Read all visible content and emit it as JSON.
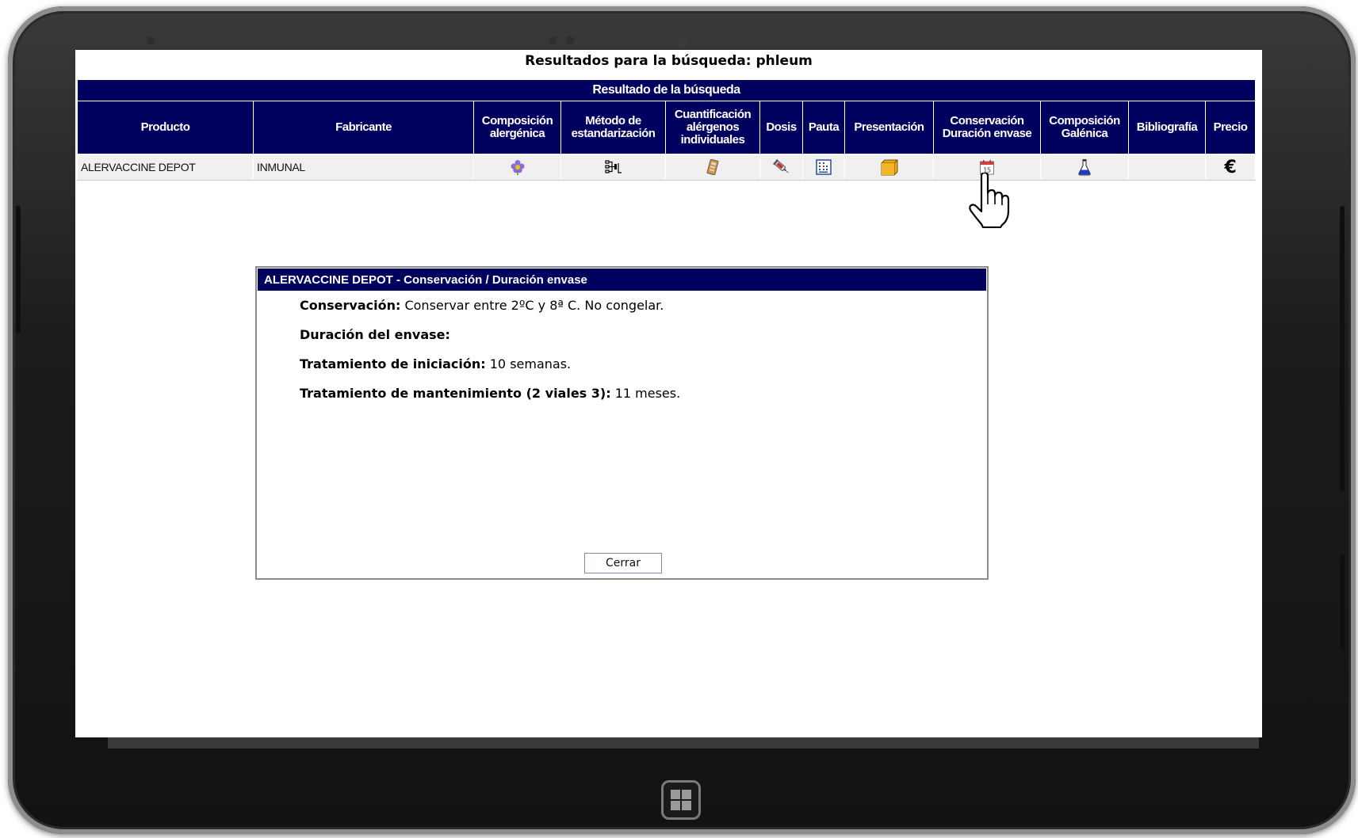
{
  "page": {
    "title": "Resultados para la búsqueda: phleum"
  },
  "table": {
    "caption": "Resultado de la búsqueda",
    "headers": {
      "producto": "Producto",
      "fabricante": "Fabricante",
      "composicion_alergenica": "Composición alergénica",
      "metodo": "Método de estandarización",
      "cuantificacion": "Cuantificación alérgenos individuales",
      "dosis": "Dosis",
      "pauta": "Pauta",
      "presentacion": "Presentación",
      "conservacion": "Conservación Duración envase",
      "composicion_galenica": "Composición Galénica",
      "bibliografia": "Bibliografía",
      "precio": "Precio"
    },
    "rows": [
      {
        "producto": "ALERVACCINE DEPOT",
        "fabricante": "INMUNAL",
        "icons": {
          "composicion_alergenica": "flower-icon",
          "metodo": "standardization-icon",
          "cuantificacion": "quantification-icon",
          "dosis": "syringe-icon",
          "pauta": "schedule-grid-icon",
          "presentacion": "box-icon",
          "conservacion": "calendar-icon",
          "composicion_galenica": "flask-icon",
          "precio": "euro-icon"
        },
        "calendar_day": "15",
        "precio_symbol": "€"
      }
    ]
  },
  "modal": {
    "title": "ALERVACCINE DEPOT - Conservación / Duración envase",
    "conservacion_label": "Conservación:",
    "conservacion_value": " Conservar entre 2ºC y 8ª C. No congelar.",
    "duracion_label": "Duración del envase:",
    "iniciacion_label": "Tratamiento de iniciación:",
    "iniciacion_value": " 10 semanas.",
    "mantenimiento_label": "Tratamiento de mantenimiento (2 viales 3):",
    "mantenimiento_value": " 11 meses.",
    "close_label": "Cerrar"
  },
  "colors": {
    "header_bg": "#00005e",
    "row_bg": "#f0f0f0",
    "frame": "#1c1c1c"
  }
}
